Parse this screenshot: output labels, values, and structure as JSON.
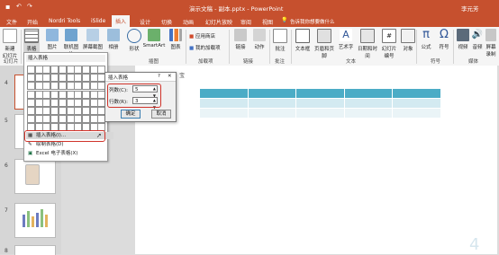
{
  "title": {
    "text": "演示文稿 - 副本.pptx - PowerPoint",
    "user": "李元芳"
  },
  "tabs": [
    "文件",
    "开始",
    "Nordri Tools",
    "iSlide",
    "插入",
    "设计",
    "切换",
    "动画",
    "幻灯片放映",
    "审阅",
    "视图"
  ],
  "search": {
    "placeholder": "告诉我你想要做什么"
  },
  "ribbon": {
    "new_slide": "新建\n幻灯片",
    "table": "表格",
    "picture": "图片",
    "online_picture": "联机图片",
    "screenshot": "屏幕截图",
    "album": "相册",
    "shape": "形状",
    "smartart": "SmartArt",
    "chart": "图表",
    "store": "应用商店",
    "my_addins": "我的加载项",
    "link": "链接",
    "action": "动作",
    "comment": "批注",
    "textbox": "文本框",
    "header_footer": "页眉和页脚",
    "wordart": "艺术字",
    "datetime": "日期和时间",
    "slide_number": "幻灯片\n编号",
    "object": "对象",
    "equation": "公式",
    "symbol": "符号",
    "video": "视频",
    "audio": "音频",
    "screen_record": "屏幕\n录制",
    "groups": {
      "slides": "幻灯片",
      "illustrations": "插图",
      "addins": "加载项",
      "links": "链接",
      "comments": "批注",
      "text": "文本",
      "symbols": "符号",
      "media": "媒体"
    }
  },
  "table_menu": {
    "header": "插入表格",
    "insert_table": "插入表格(I)...",
    "draw_table": "绘制表格(D)",
    "excel_table": "Excel 电子表格(X)"
  },
  "dialog": {
    "title": "插入表格",
    "help": "?",
    "close": "✕",
    "columns_label": "列数(C):",
    "columns_value": "5",
    "rows_label": "行数(R):",
    "rows_value": "3",
    "ok": "确定",
    "cancel": "取消"
  },
  "slides": [
    "4",
    "5",
    "6",
    "7",
    "8"
  ],
  "slide_text": "宝",
  "colors": {
    "accent": "#c6502e",
    "table_header": "#4bacc6",
    "table_band": "#d3eaf1"
  }
}
